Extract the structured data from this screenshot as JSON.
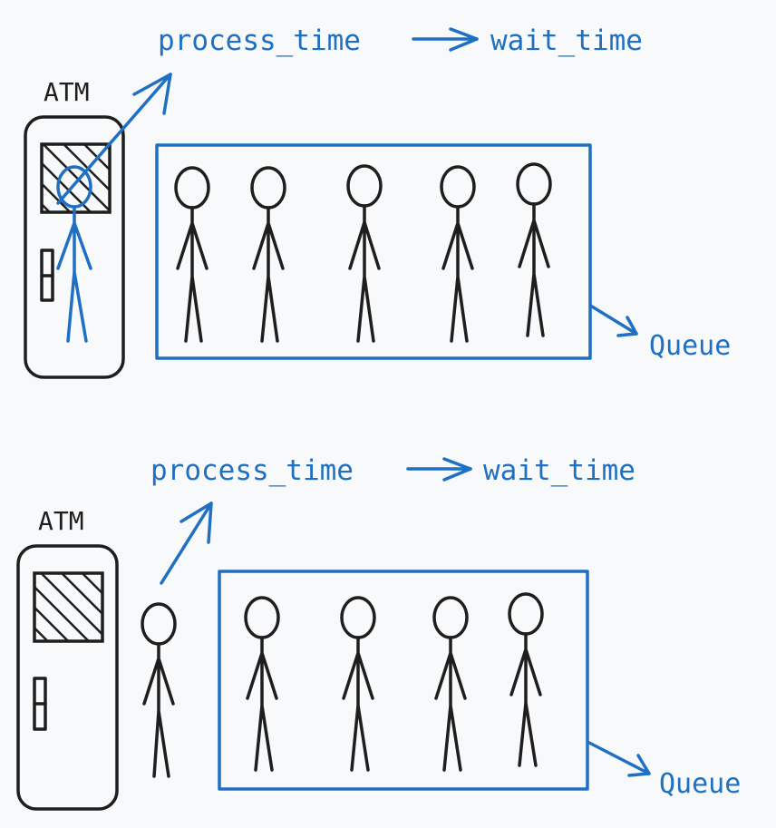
{
  "panels": [
    {
      "atm_label": "ATM",
      "process_time_label": "process_time",
      "wait_time_label": "wait_time",
      "queue_label": "Queue",
      "person_at_atm": true,
      "queue_people_count": 5
    },
    {
      "atm_label": "ATM",
      "process_time_label": "process_time",
      "wait_time_label": "wait_time",
      "queue_label": "Queue",
      "person_at_atm": false,
      "queue_people_count": 5
    }
  ],
  "colors": {
    "accent": "#1f6fc3",
    "ink": "#1e1e1e",
    "background": "#f8f9fa"
  }
}
